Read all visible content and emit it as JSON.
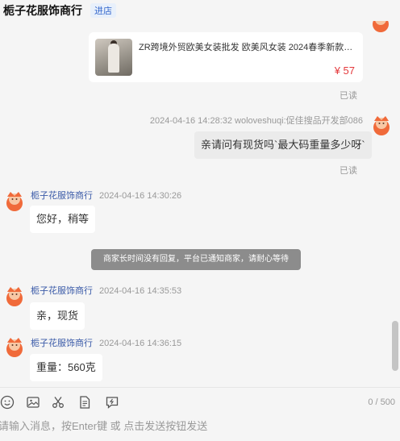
{
  "header": {
    "shop_name": "栀子花服饰商行",
    "enter_label": "进店"
  },
  "product": {
    "name": "ZR跨境外贸欧美女装批发 欧美风女装 2024春季新款拼...",
    "price": "¥ 57"
  },
  "messages": {
    "read_label_1": "已读",
    "buyer_meta": "2024-04-16 14:28:32  woloveshuqi:促佳搜品开发部086",
    "buyer_text": "亲请问有现货吗`最大码重量多少呀`",
    "read_label_2": "已读",
    "msg1": {
      "name": "栀子花服饰商行",
      "time": "2024-04-16 14:30:26",
      "text": "您好，稍等"
    },
    "notice": "商家长时间没有回复，平台已通知商家，请耐心等待",
    "msg2": {
      "name": "栀子花服饰商行",
      "time": "2024-04-16 14:35:53",
      "text": "亲，现货"
    },
    "msg3": {
      "name": "栀子花服饰商行",
      "time": "2024-04-16 14:36:15",
      "text": "重量：560克"
    }
  },
  "toolbar": {
    "icons": [
      "emoji-icon",
      "image-icon",
      "scissors-icon",
      "document-icon",
      "quick-reply-icon"
    ],
    "counter": "0 / 500"
  },
  "input": {
    "value": "",
    "placeholder": "请输入消息，按Enter键 或 点击发送按钮发送"
  },
  "colors": {
    "price": "#e4393c",
    "sender_name": "#3a5aa8",
    "enter_badge": "#3366cc",
    "avatar": "#f06a3a"
  }
}
